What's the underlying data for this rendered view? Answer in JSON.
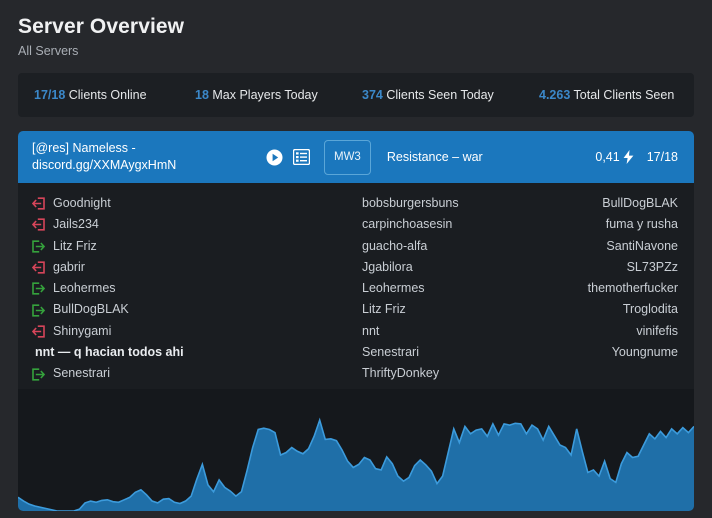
{
  "header": {
    "title": "Server Overview",
    "subtitle": "All Servers"
  },
  "stats": [
    {
      "value": "17/18",
      "label": " Clients Online"
    },
    {
      "value": "18",
      "label": " Max Players Today"
    },
    {
      "value": "374",
      "label": " Clients Seen Today"
    },
    {
      "value": "4.263",
      "label": " Total Clients Seen"
    }
  ],
  "server": {
    "name": "[@res] Nameless - discord.gg/XXMAygxHmN",
    "play_icon": "play-circle-icon",
    "list_icon": "list-icon",
    "game_badge": "MW3",
    "map": "Resistance – war",
    "score": "0,41",
    "bolt_icon": "lightning-bolt-icon",
    "players": "17/18"
  },
  "events": [
    {
      "type": "leave",
      "name": "Goodnight"
    },
    {
      "type": "leave",
      "name": "Jails234"
    },
    {
      "type": "join",
      "name": "Litz Friz"
    },
    {
      "type": "leave",
      "name": "gabrir"
    },
    {
      "type": "join",
      "name": "Leohermes"
    },
    {
      "type": "join",
      "name": "BullDogBLAK"
    },
    {
      "type": "leave",
      "name": "Shinygami"
    },
    {
      "type": "chat",
      "name": "nnt — q hacian todos ahi"
    },
    {
      "type": "join",
      "name": "Senestrari"
    }
  ],
  "players_mid": [
    "bobsburgersbuns",
    "carpinchoasesin",
    "guacho-alfa",
    "Jgabilora",
    "Leohermes",
    "Litz Friz",
    "nnt",
    "Senestrari",
    "ThriftyDonkey"
  ],
  "players_right": [
    "BullDogBLAK",
    "fuma y rusha",
    "SantiNavone",
    "SL73PZz",
    "themotherfucker",
    "Troglodita",
    "vinifefis",
    "Youngnume"
  ],
  "colors": {
    "page_bg": "#26282c",
    "stat_bg": "#1c1f23",
    "card_bg": "#1a1d21",
    "accent_blue": "#3b88c9",
    "header_blue": "#1b77bd",
    "join_green": "#35a23c",
    "leave_red": "#d6455a",
    "chart_fill": "#1f6fa8",
    "chart_line": "#3c9bdc",
    "chart_bg": "#15181c"
  },
  "chart_data": {
    "type": "area",
    "title": "",
    "xlabel": "",
    "ylabel": "",
    "grid": false,
    "legend": "none",
    "ylim": [
      0,
      18
    ],
    "x": [
      0,
      1,
      2,
      3,
      4,
      5,
      6,
      7,
      8,
      9,
      10,
      11,
      12,
      13,
      14,
      15,
      16,
      17,
      18,
      19,
      20,
      21,
      22,
      23,
      24,
      25,
      26,
      27,
      28,
      29,
      30,
      31,
      32,
      33,
      34,
      35,
      36,
      37,
      38,
      39,
      40,
      41,
      42,
      43,
      44,
      45,
      46,
      47,
      48,
      49,
      50,
      51,
      52,
      53,
      54,
      55,
      56,
      57,
      58,
      59,
      60,
      61,
      62,
      63,
      64,
      65,
      66,
      67,
      68,
      69,
      70,
      71,
      72,
      73,
      74,
      75,
      76,
      77,
      78,
      79,
      80,
      81,
      82,
      83,
      84,
      85,
      86,
      87,
      88,
      89,
      90,
      91,
      92,
      93,
      94,
      95,
      96,
      97,
      98,
      99,
      100,
      101,
      102,
      103,
      104,
      105,
      106,
      107,
      108,
      109,
      110,
      111,
      112,
      113,
      114,
      115,
      116,
      117,
      118,
      119
    ],
    "values": [
      2.2,
      1.6,
      1.1,
      0.8,
      0.6,
      0.4,
      0.2,
      0.0,
      0.0,
      0.0,
      0.0,
      0.3,
      1.3,
      1.6,
      1.4,
      1.7,
      1.8,
      1.5,
      1.4,
      1.8,
      2.2,
      3.0,
      3.4,
      2.6,
      1.6,
      1.3,
      1.9,
      2.0,
      1.4,
      1.2,
      1.6,
      2.4,
      5.1,
      7.5,
      4.2,
      3.1,
      5.0,
      3.8,
      3.2,
      2.4,
      3.1,
      6.5,
      10.2,
      13.1,
      13.3,
      13.1,
      12.6,
      9.0,
      9.4,
      10.2,
      9.6,
      9.2,
      10.0,
      12.0,
      14.6,
      11.5,
      11.6,
      11.3,
      9.8,
      8.0,
      7.0,
      7.5,
      8.6,
      8.2,
      6.8,
      6.6,
      8.7,
      7.6,
      5.6,
      4.8,
      5.4,
      7.3,
      8.2,
      7.4,
      6.4,
      4.4,
      5.6,
      9.4,
      13.2,
      11.0,
      13.6,
      12.4,
      13.0,
      13.2,
      12.0,
      14.0,
      12.2,
      14.0,
      13.8,
      14.1,
      14.0,
      12.4,
      13.8,
      13.2,
      11.4,
      13.6,
      12.1,
      10.6,
      10.2,
      9.0,
      13.2,
      9.6,
      6.2,
      6.6,
      5.6,
      8.0,
      5.2,
      4.6,
      7.6,
      9.4,
      8.6,
      8.8,
      10.6,
      12.4,
      11.6,
      12.8,
      11.8,
      13.2,
      12.4,
      13.4,
      12.6,
      13.6
    ]
  }
}
